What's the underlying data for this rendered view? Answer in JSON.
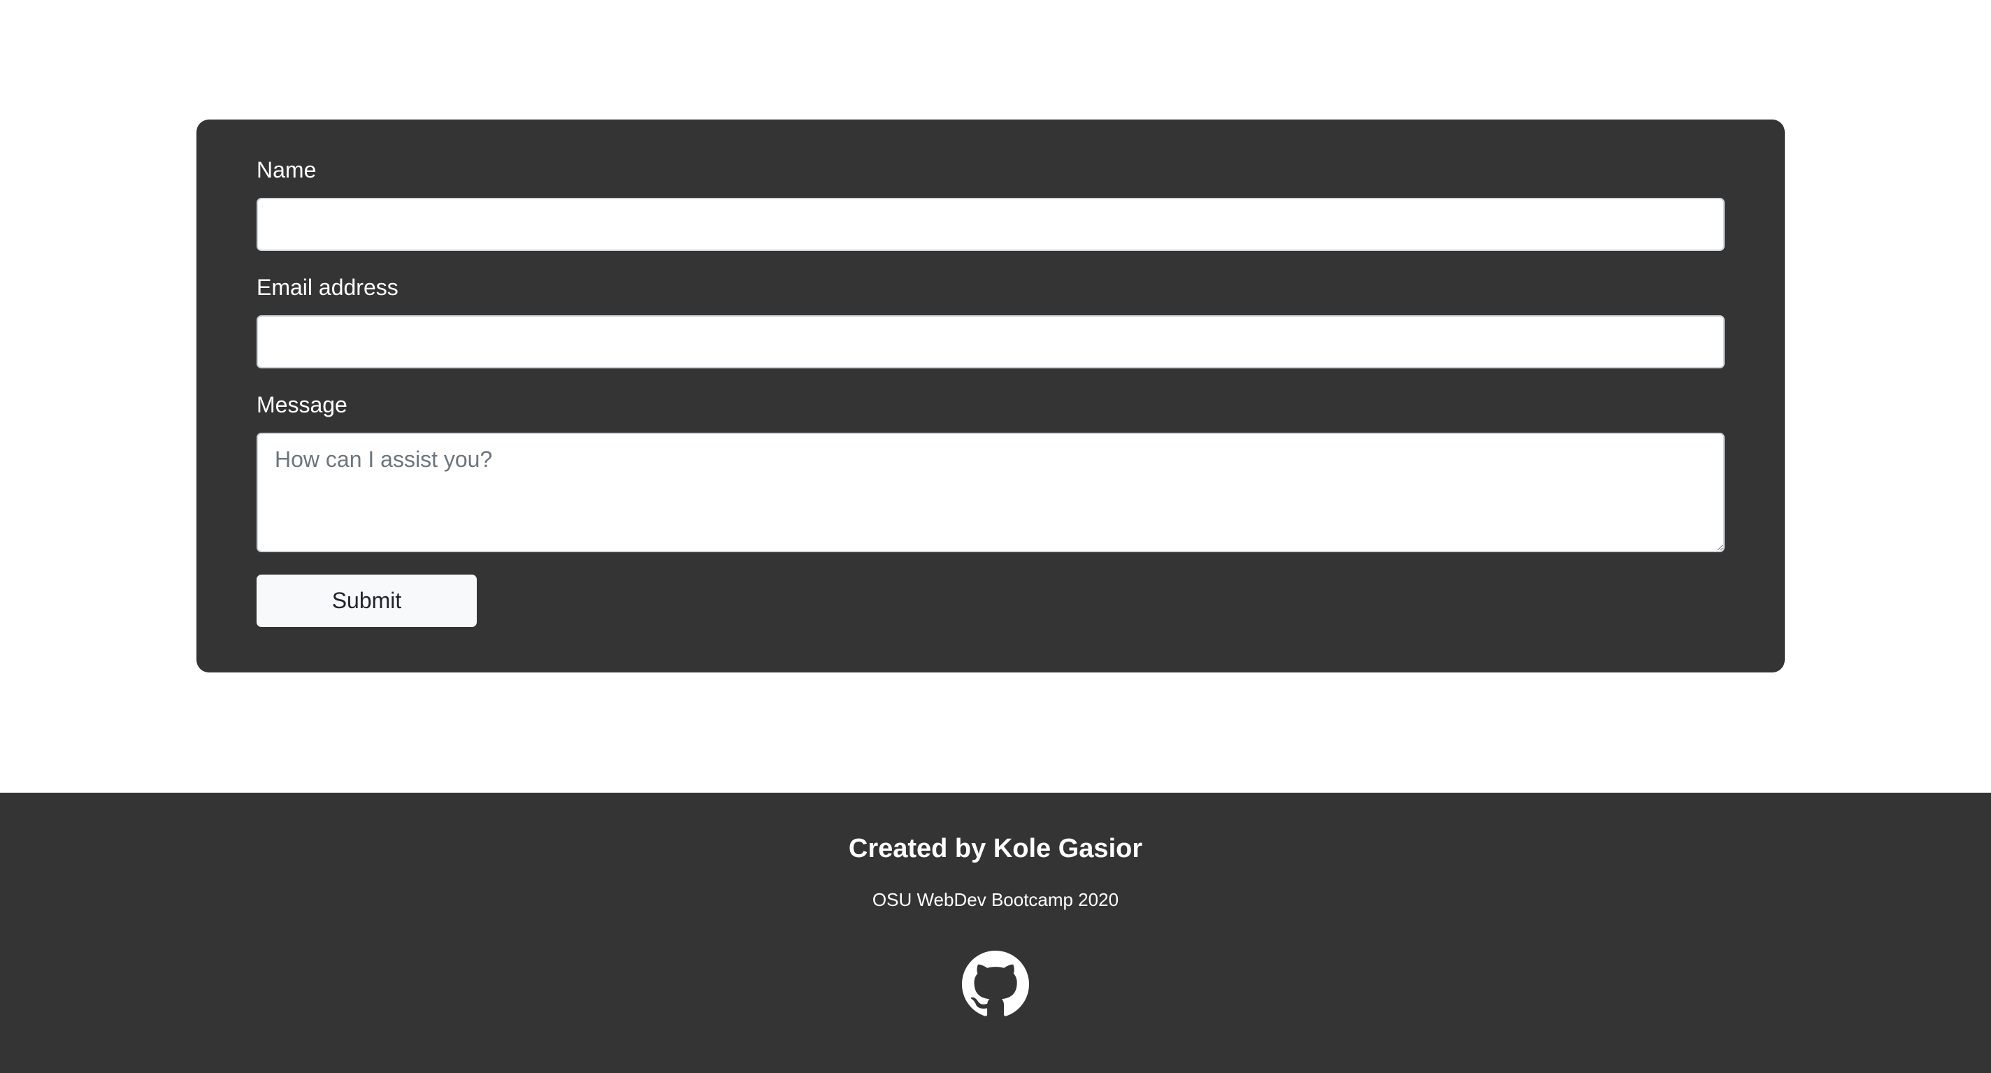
{
  "form": {
    "name_label": "Name",
    "name_value": "",
    "email_label": "Email address",
    "email_value": "",
    "message_label": "Message",
    "message_placeholder": "How can I assist you?",
    "message_value": "",
    "submit_label": "Submit"
  },
  "footer": {
    "title": "Created by Kole Gasior",
    "subtitle": "OSU WebDev Bootcamp 2020",
    "icon": "github-icon"
  },
  "colors": {
    "panel_background": "#343434",
    "page_background": "#ffffff",
    "button_background": "#f8f9fa",
    "text_light": "#ffffff"
  }
}
